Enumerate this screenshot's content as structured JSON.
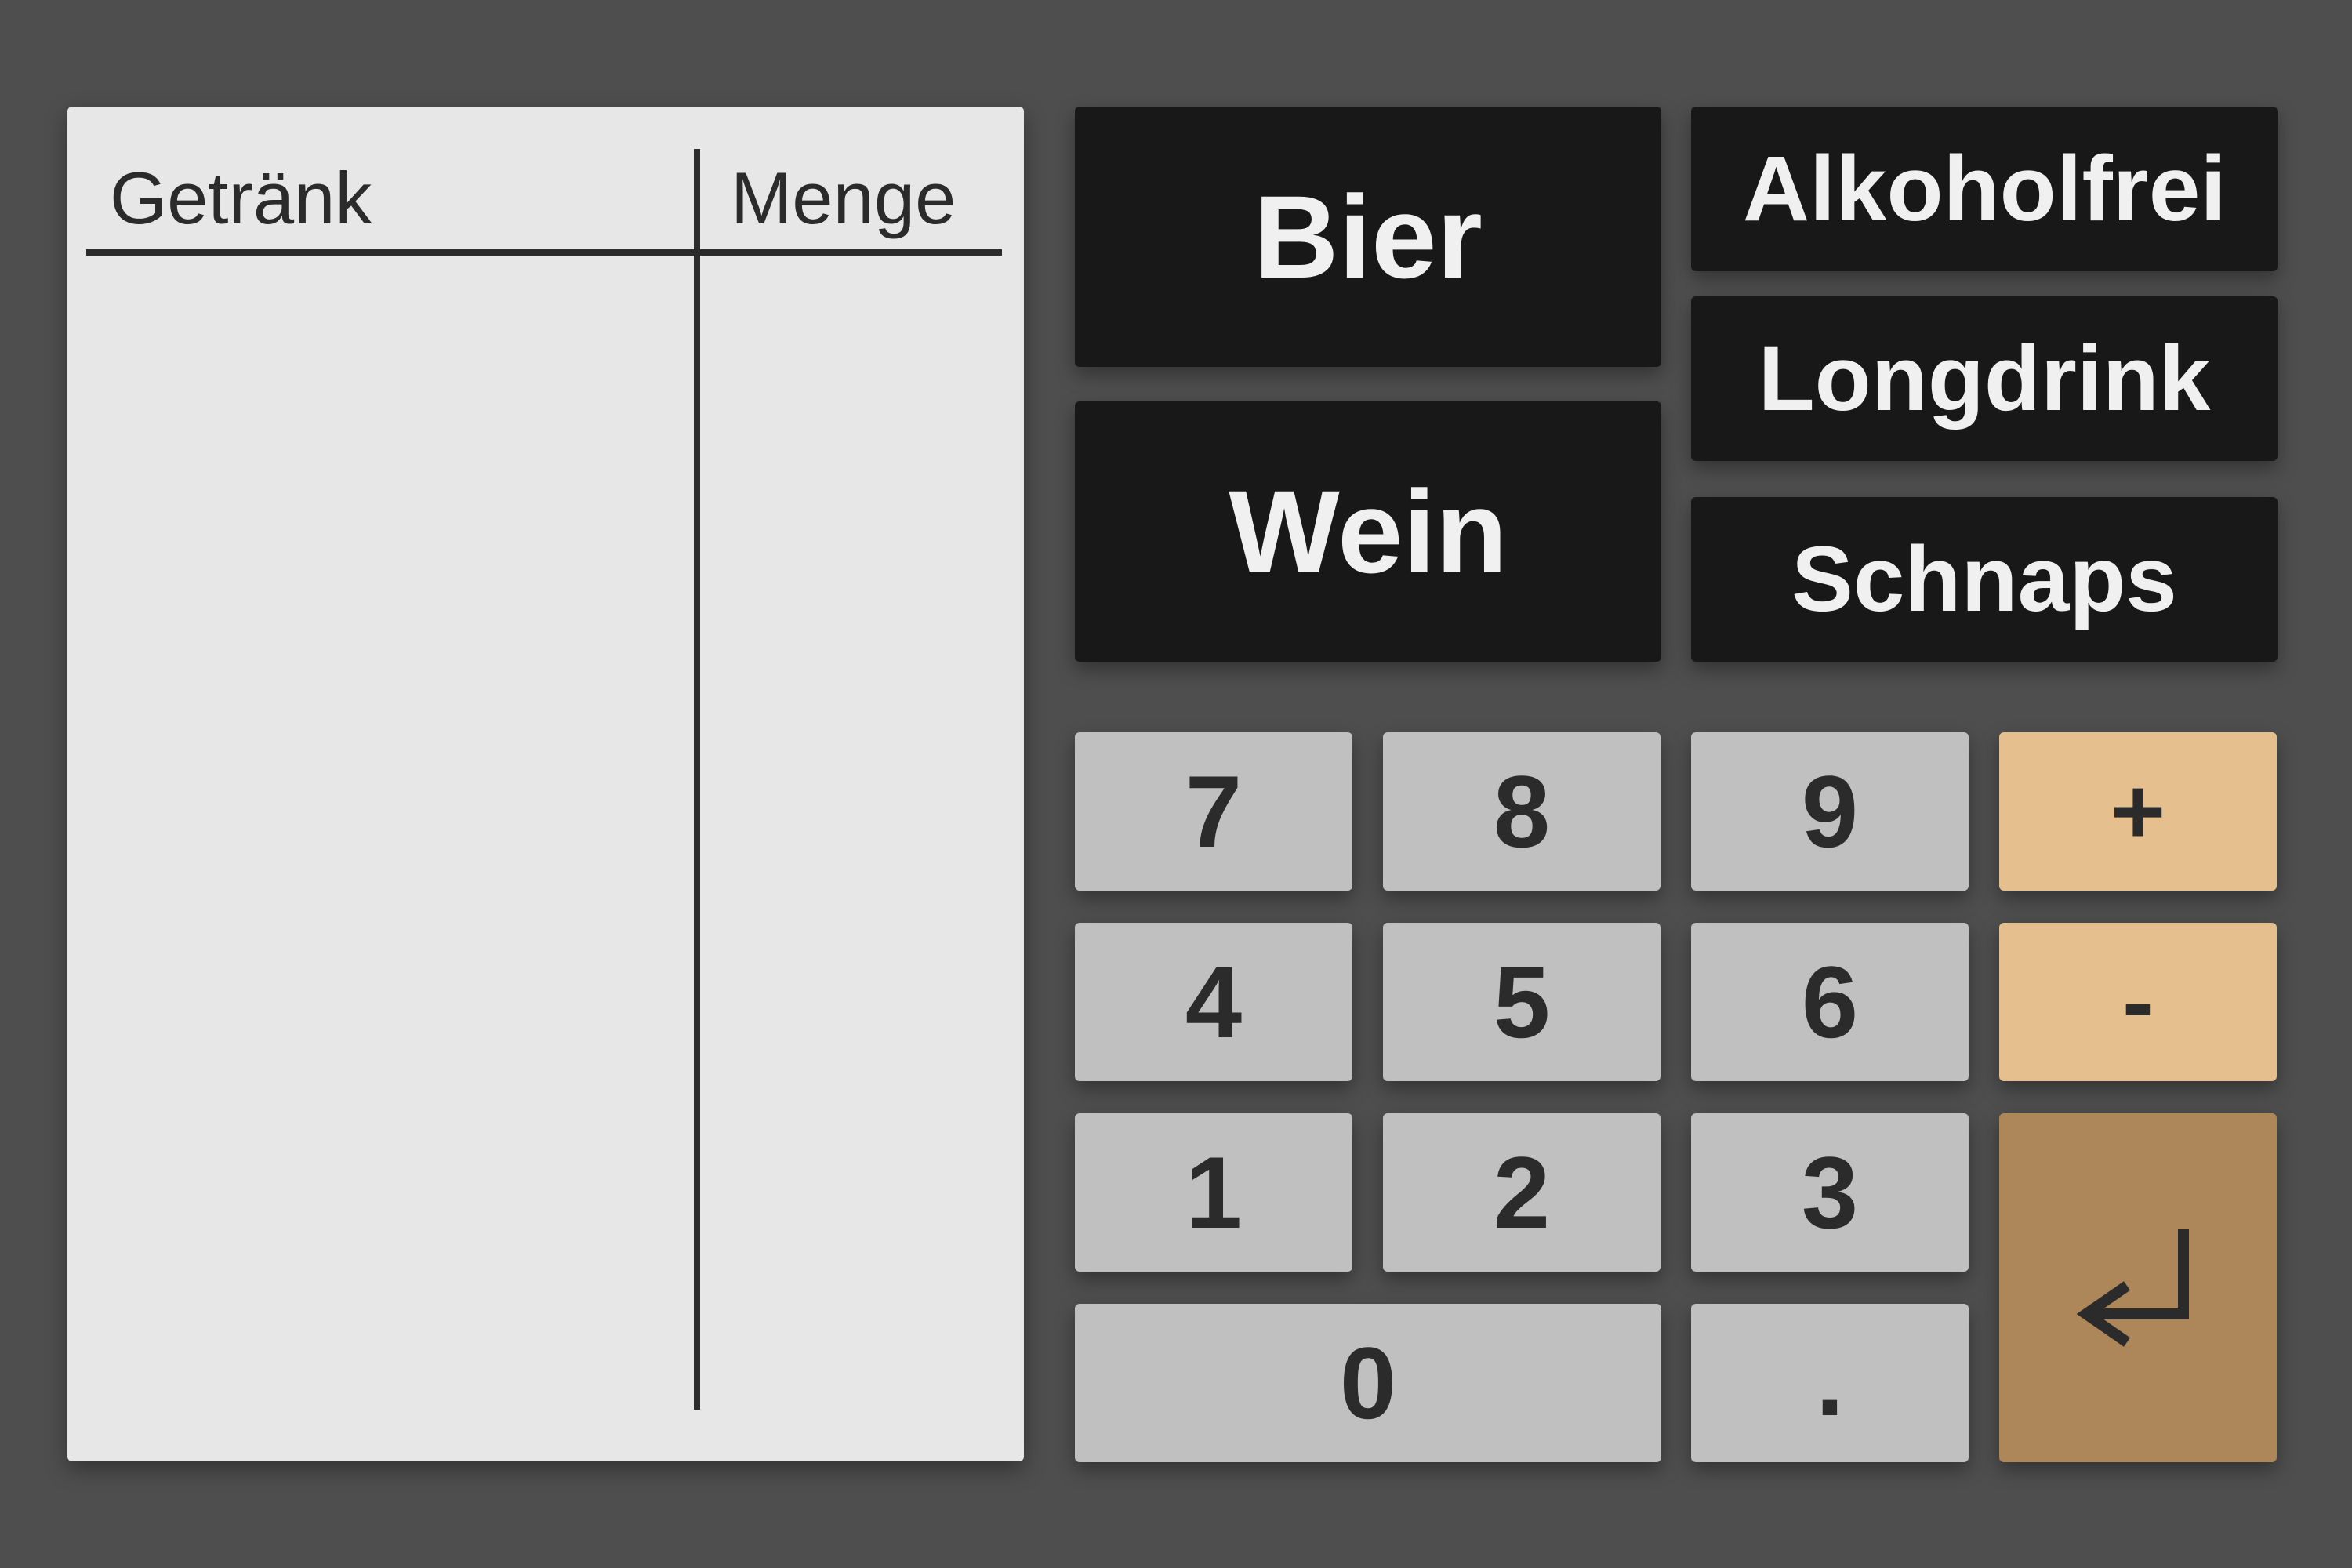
{
  "order_table": {
    "column_drink": "Getränk",
    "column_quantity": "Menge",
    "rows": []
  },
  "categories": {
    "bier": "Bier",
    "wein": "Wein",
    "alkoholfrei": "Alkoholfrei",
    "longdrink": "Longdrink",
    "schnaps": "Schnaps"
  },
  "keypad": {
    "seven": "7",
    "eight": "8",
    "nine": "9",
    "four": "4",
    "five": "5",
    "six": "6",
    "one": "1",
    "two": "2",
    "three": "3",
    "zero": "0",
    "decimal": ".",
    "plus": "+",
    "minus": "-",
    "enter_icon": "enter-return-icon"
  },
  "colors": {
    "background": "#4e4e4e",
    "panel": "#e7e7e7",
    "category_button": "#181818",
    "number_key": "#c0c0c0",
    "operator_key": "#e5bf8d",
    "enter_key": "#ad8659"
  }
}
